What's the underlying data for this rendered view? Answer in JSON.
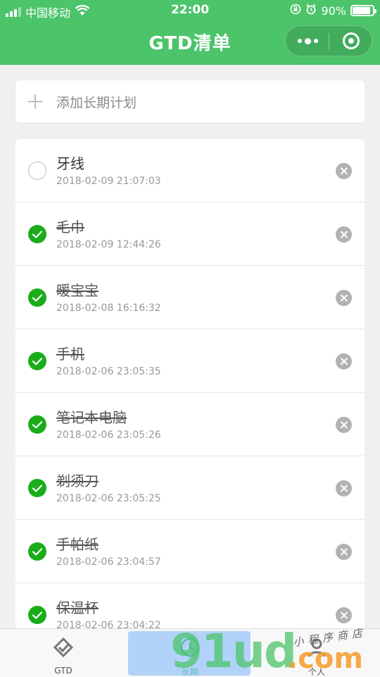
{
  "status_bar": {
    "carrier": "中国移动",
    "time": "22:00",
    "battery": "90%",
    "battery_level": 0.9
  },
  "nav": {
    "title": "GTD清单"
  },
  "add": {
    "placeholder": "添加长期计划"
  },
  "items": [
    {
      "title": "牙线",
      "time": "2018-02-09 21:07:03",
      "done": false
    },
    {
      "title": "毛巾",
      "time": "2018-02-09 12:44:26",
      "done": true
    },
    {
      "title": "暖宝宝",
      "time": "2018-02-08 16:16:32",
      "done": true
    },
    {
      "title": "手机",
      "time": "2018-02-06 23:05:35",
      "done": true
    },
    {
      "title": "笔记本电脑",
      "time": "2018-02-06 23:05:26",
      "done": true
    },
    {
      "title": "剃须刀",
      "time": "2018-02-06 23:05:25",
      "done": true
    },
    {
      "title": "手帕纸",
      "time": "2018-02-06 23:04:57",
      "done": true
    },
    {
      "title": "保温杯",
      "time": "2018-02-06 23:04:22",
      "done": true
    }
  ],
  "tabs": [
    {
      "label": "GTD",
      "icon": "gtd-icon"
    },
    {
      "label": "长期",
      "icon": "clock-icon",
      "active": true
    },
    {
      "label": "个人",
      "icon": "person-icon"
    }
  ],
  "watermark": {
    "digits": "91ud",
    "dotcom": ".com",
    "script": "小程序商店"
  },
  "colors": {
    "brand": "#4cc46a",
    "check": "#1aad19",
    "delete": "#b2b2b2"
  }
}
